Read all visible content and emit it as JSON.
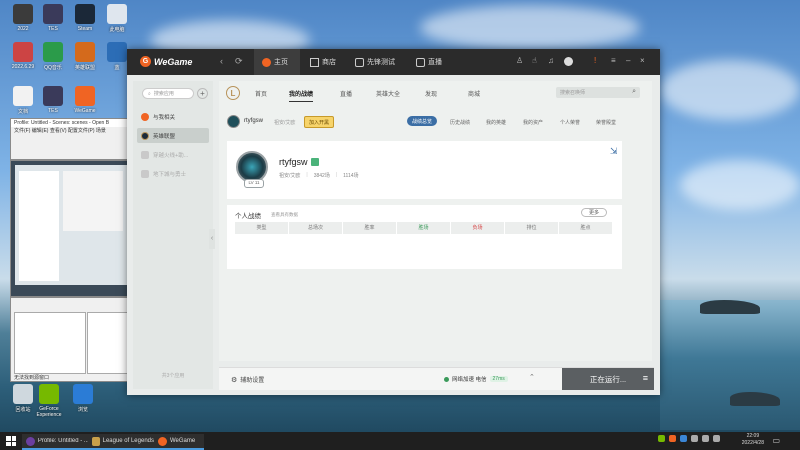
{
  "desktop_icons": [
    {
      "label": "2022",
      "color": "#3b3b3b"
    },
    {
      "label": "TES",
      "color": "#3a3a5a"
    },
    {
      "label": "Steam",
      "color": "#1b2838"
    },
    {
      "label": "此电脑",
      "color": "#dfe6ee"
    },
    {
      "label": "2022.6.29",
      "color": "#c44"
    },
    {
      "label": "QQ音乐",
      "color": "#2b9b4a"
    },
    {
      "label": "英雄联盟",
      "color": "#d46a1c"
    },
    {
      "label": "蓝",
      "color": "#2c6db6"
    },
    {
      "label": "文档",
      "color": "#f2f2f2"
    },
    {
      "label": "TES",
      "color": "#3a3a5a"
    },
    {
      "label": "WeGame",
      "color": "#f06423"
    },
    {
      "label": "GeForce Experience",
      "color": "#76b900"
    },
    {
      "label": "浏览",
      "color": "#2b7cd6"
    },
    {
      "label": "回收站",
      "color": "#cfd8de"
    }
  ],
  "taskbar": {
    "items": [
      {
        "label": "Profile: Untitled - ...",
        "color": "#6b3fa0"
      },
      {
        "label": "League of Legends",
        "color": "#c8a04a"
      },
      {
        "label": "WeGame",
        "color": "#f06423"
      }
    ],
    "time": "22:09",
    "date": "2022/4/28"
  },
  "wegame": {
    "brand": "WeGame",
    "tabs": [
      {
        "label": "主页",
        "active": true
      },
      {
        "label": "商店",
        "active": false
      },
      {
        "label": "先锋测试",
        "active": false
      },
      {
        "label": "直播",
        "active": false
      }
    ],
    "sidebar": {
      "search_placeholder": "搜索应用",
      "items": [
        {
          "label": "与我相关",
          "active": false,
          "dim": false
        },
        {
          "label": "英雄联盟",
          "active": true,
          "dim": false
        },
        {
          "label": "穿越火线+助...",
          "active": false,
          "dim": true
        },
        {
          "label": "地下城与勇士",
          "active": false,
          "dim": true
        }
      ],
      "footer": "共3个应用"
    },
    "game_tabs": [
      {
        "label": "首页",
        "active": false
      },
      {
        "label": "我的战绩",
        "active": true
      },
      {
        "label": "直播",
        "active": false
      },
      {
        "label": "英雄大全",
        "active": false
      },
      {
        "label": "发现",
        "active": false
      },
      {
        "label": "商城",
        "active": false
      }
    ],
    "game_search_placeholder": "搜索召唤师",
    "user": {
      "name": "rtyfgsw",
      "server": "祖安/艾欧",
      "badge": "加入开黑"
    },
    "sub_tabs": [
      {
        "label": "战绩总览",
        "active": true
      },
      {
        "label": "历史战绩",
        "active": false
      },
      {
        "label": "我的英雄",
        "active": false
      },
      {
        "label": "我的资产",
        "active": false
      },
      {
        "label": "个人荣誉",
        "active": false
      },
      {
        "label": "荣誉殿堂",
        "active": false
      }
    ],
    "profile": {
      "name": "rtyfgsw",
      "level": "LV 11",
      "server": "祖安/艾欧",
      "stat1": "3842场",
      "stat2": "1114场"
    },
    "stats_card": {
      "title": "个人战绩",
      "subtitle": "查看具有数据",
      "more": "更多",
      "columns": [
        "类型",
        "总场次",
        "胜率",
        "胜场",
        "负场",
        "排位",
        "胜点"
      ]
    },
    "bottom": {
      "settings": "辅助设置",
      "network": "网络加速 电信",
      "ping": "27ms",
      "running": "正在运行..."
    }
  }
}
